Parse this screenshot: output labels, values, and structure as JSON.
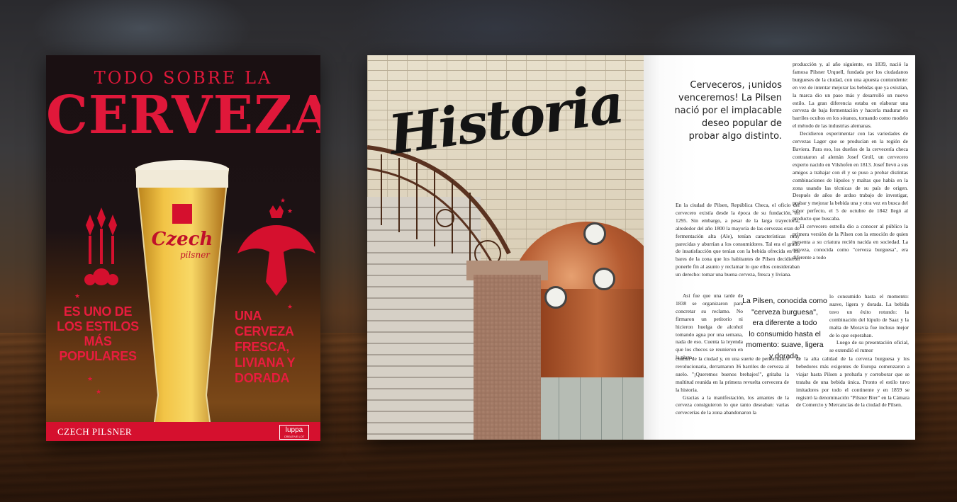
{
  "cover": {
    "kicker": "TODO SOBRE LA",
    "title": "CERVEZA",
    "glass_brand": "Czech",
    "glass_sub": "pilsner",
    "left_text": [
      "ES UNO DE",
      "LOS ESTILOS",
      "MÁS",
      "POPULARES"
    ],
    "right_text": [
      "UNA",
      "CERVEZA",
      "FRESCA,",
      "LIVIANA Y",
      "DORADA"
    ],
    "bottom_label": "CZECH PILSNER",
    "publisher": "luppa",
    "publisher_sub": "CREATIVE LOT",
    "accent": "#e0183a"
  },
  "spread": {
    "headline": "Historia",
    "pull_top": "Cerveceros, ¡unidos venceremos! La Pilsen nació por el implacable deseo popular de probar algo distinto.",
    "pull_mid": [
      "La Pilsen, conocida como",
      "\"cerveza burguesa\",",
      "era diferente a todo",
      "lo consumido hasta el",
      "momento: suave, ligera",
      "y dorada."
    ],
    "col_left": "En la ciudad de Pilsen, República Checa, el oficio del cervecero existía desde la época de su fundación, en 1295. Sin embargo, a pesar de la larga trayectoria, alrededor del año 1800 la mayoría de las cervezas eran de fermentación alta (Ale), tenían características muy parecidas y aburrían a los consumidores. Tal era el grado de insatisfacción que tenían con la bebida ofrecida en los bares de la zona que los habitantes de Pilsen decidieron ponerle fin al asunto y reclamar lo que ellos consideraban un derecho: tomar una buena cerveza, fresca y liviana.",
    "col_mid_left": "Así fue que una tarde de 1838 se organizaron para concretar su reclamo. No firmaron un petitorio ni hicieron huelga de alcohol tomando agua por una semana, nada de eso. Cuenta la leyenda que los checos se reunieron en la plaza",
    "col_bottom_1": "central de la ciudad y, en una suerte de performance revolucionaria, derramaron 36 barriles de cerveza al suelo. \"¡Queremos buenos brebajes!\", gritaba la multitud reunida en la primera revuelta cervecera de la historia.",
    "col_bottom_2": "Gracias a la manifestación, los amantes de la cerveza consiguieron lo que tanto deseaban: varias cervecerías de la zona abandonaron la",
    "col_right": "producción y, al año siguiente, en 1839, nació la famosa Pilsner Urquell, fundada por los ciudadanos burgueses de la ciudad, con una apuesta contundente: en vez de intentar mejorar las bebidas que ya existían, la marca dio un paso más y desarrolló un nuevo estilo. La gran diferencia estaba en elaborar una cerveza de baja fermentación y hacerla madurar en barriles ocultos en los sótanos, tomando como modelo el método de las industrias alemanas.",
    "col_right_b": "Decidieron experimentar con las variedades de cervezas Lager que se producían en la región de Baviera. Para eso, los dueños de la cervecería checa contrataron al alemán Josef Groll, un cervecero experto nacido en Vilshofen en 1813. Josef llevó a sus amigos a trabajar con él y se puso a probar distintas combinaciones de lúpulos y maltas que había en la zona usando las técnicas de su país de origen. Después de años de arduo trabajo de investigar, probar y mejorar la bebida una y otra vez en busca del sabor perfecto, el 5 de octubre de 1842 llegó al producto que buscaba.",
    "col_right_c": "El cervecero estrella dio a conocer al público la primera versión de la Pilsen con la emoción de quien presenta a su criatura recién nacida en sociedad. La cerveza, conocida como \"cerveza burguesa\", era diferente a todo",
    "col_right2": "lo consumido hasta el momento: suave, ligera y dorada. La bebida tuvo un éxito rotundo: la combinación del lúpulo de Saaz y la malta de Moravia fue incluso mejor de lo que esperaban.",
    "col_right2_b": "Luego de su presentación oficial, se extendió el rumor",
    "col_bottom_3": "de la alta calidad de la cerveza burguesa y los bebedores más exigentes de Europa comenzaron a viajar hasta Pilsen a probarla y corroborar que se trataba de una bebida única. Pronto el estilo tuvo imitadores por todo el continente y en 1859 se registró la denominación \"Pilsner Bier\" en la Cámara de Comercio y Mercancías de la ciudad de Pilsen."
  }
}
